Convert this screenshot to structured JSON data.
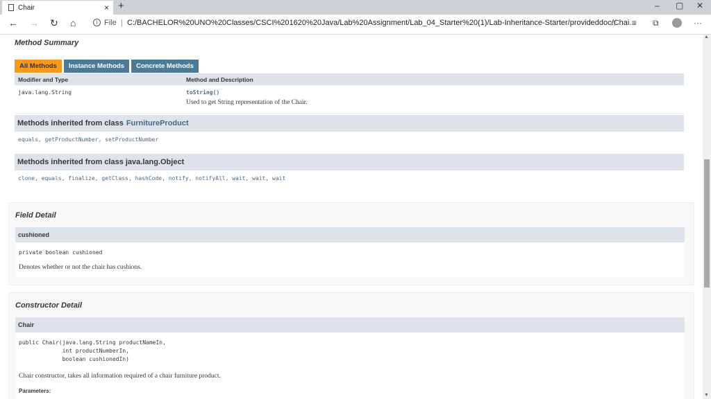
{
  "browser": {
    "tab_title": "Chair",
    "new_tab_glyph": "+",
    "close_glyph": "×",
    "url_prefix": "File",
    "url_separator": "|",
    "url": "C:/BACHELOR%20UNO%20Classes/CSCI%201620%20Java/Lab%20Assignment/Lab_04_Starter%20(1)/Lab-Inheritance-Starter/provideddoc/Chai...",
    "icons": [
      "back-icon",
      "forward-icon",
      "refresh-icon",
      "home-icon",
      "info-icon",
      "favorite-star-icon",
      "favorites-list-icon",
      "collections-icon",
      "profile-icon",
      "more-icon",
      "minimize-icon",
      "maximize-icon",
      "close-icon"
    ]
  },
  "method_summary": {
    "title": "Method Summary",
    "tabs": [
      "All Methods",
      "Instance Methods",
      "Concrete Methods"
    ],
    "headers": {
      "modifier": "Modifier and Type",
      "method": "Method and Description"
    },
    "rows": [
      {
        "modifier": "java.lang.String",
        "method": "toString()",
        "description": "Used to get String representation of the Chair."
      }
    ]
  },
  "inherited": [
    {
      "prefix": "Methods inherited from class",
      "class_link": "FurnitureProduct",
      "methods": "equals, getProductNumber, setProductNumber"
    },
    {
      "prefix": "Methods inherited from class java.lang.Object",
      "class_link": "",
      "methods": "clone, equals, finalize, getClass, hashCode, notify, notifyAll, wait, wait, wait"
    }
  ],
  "field_detail": {
    "title": "Field Detail",
    "name": "cushioned",
    "signature": "private boolean cushioned",
    "description": "Denotes whether or not the chair has cushions."
  },
  "constructor_detail": {
    "title": "Constructor Detail",
    "name": "Chair",
    "signature": "public Chair(java.lang.String productNameIn,\n             int productNumberIn,\n             boolean cushionedIn)",
    "description": "Chair constructor, takes all information required of a chair furniture product.",
    "params_label": "Parameters:"
  }
}
